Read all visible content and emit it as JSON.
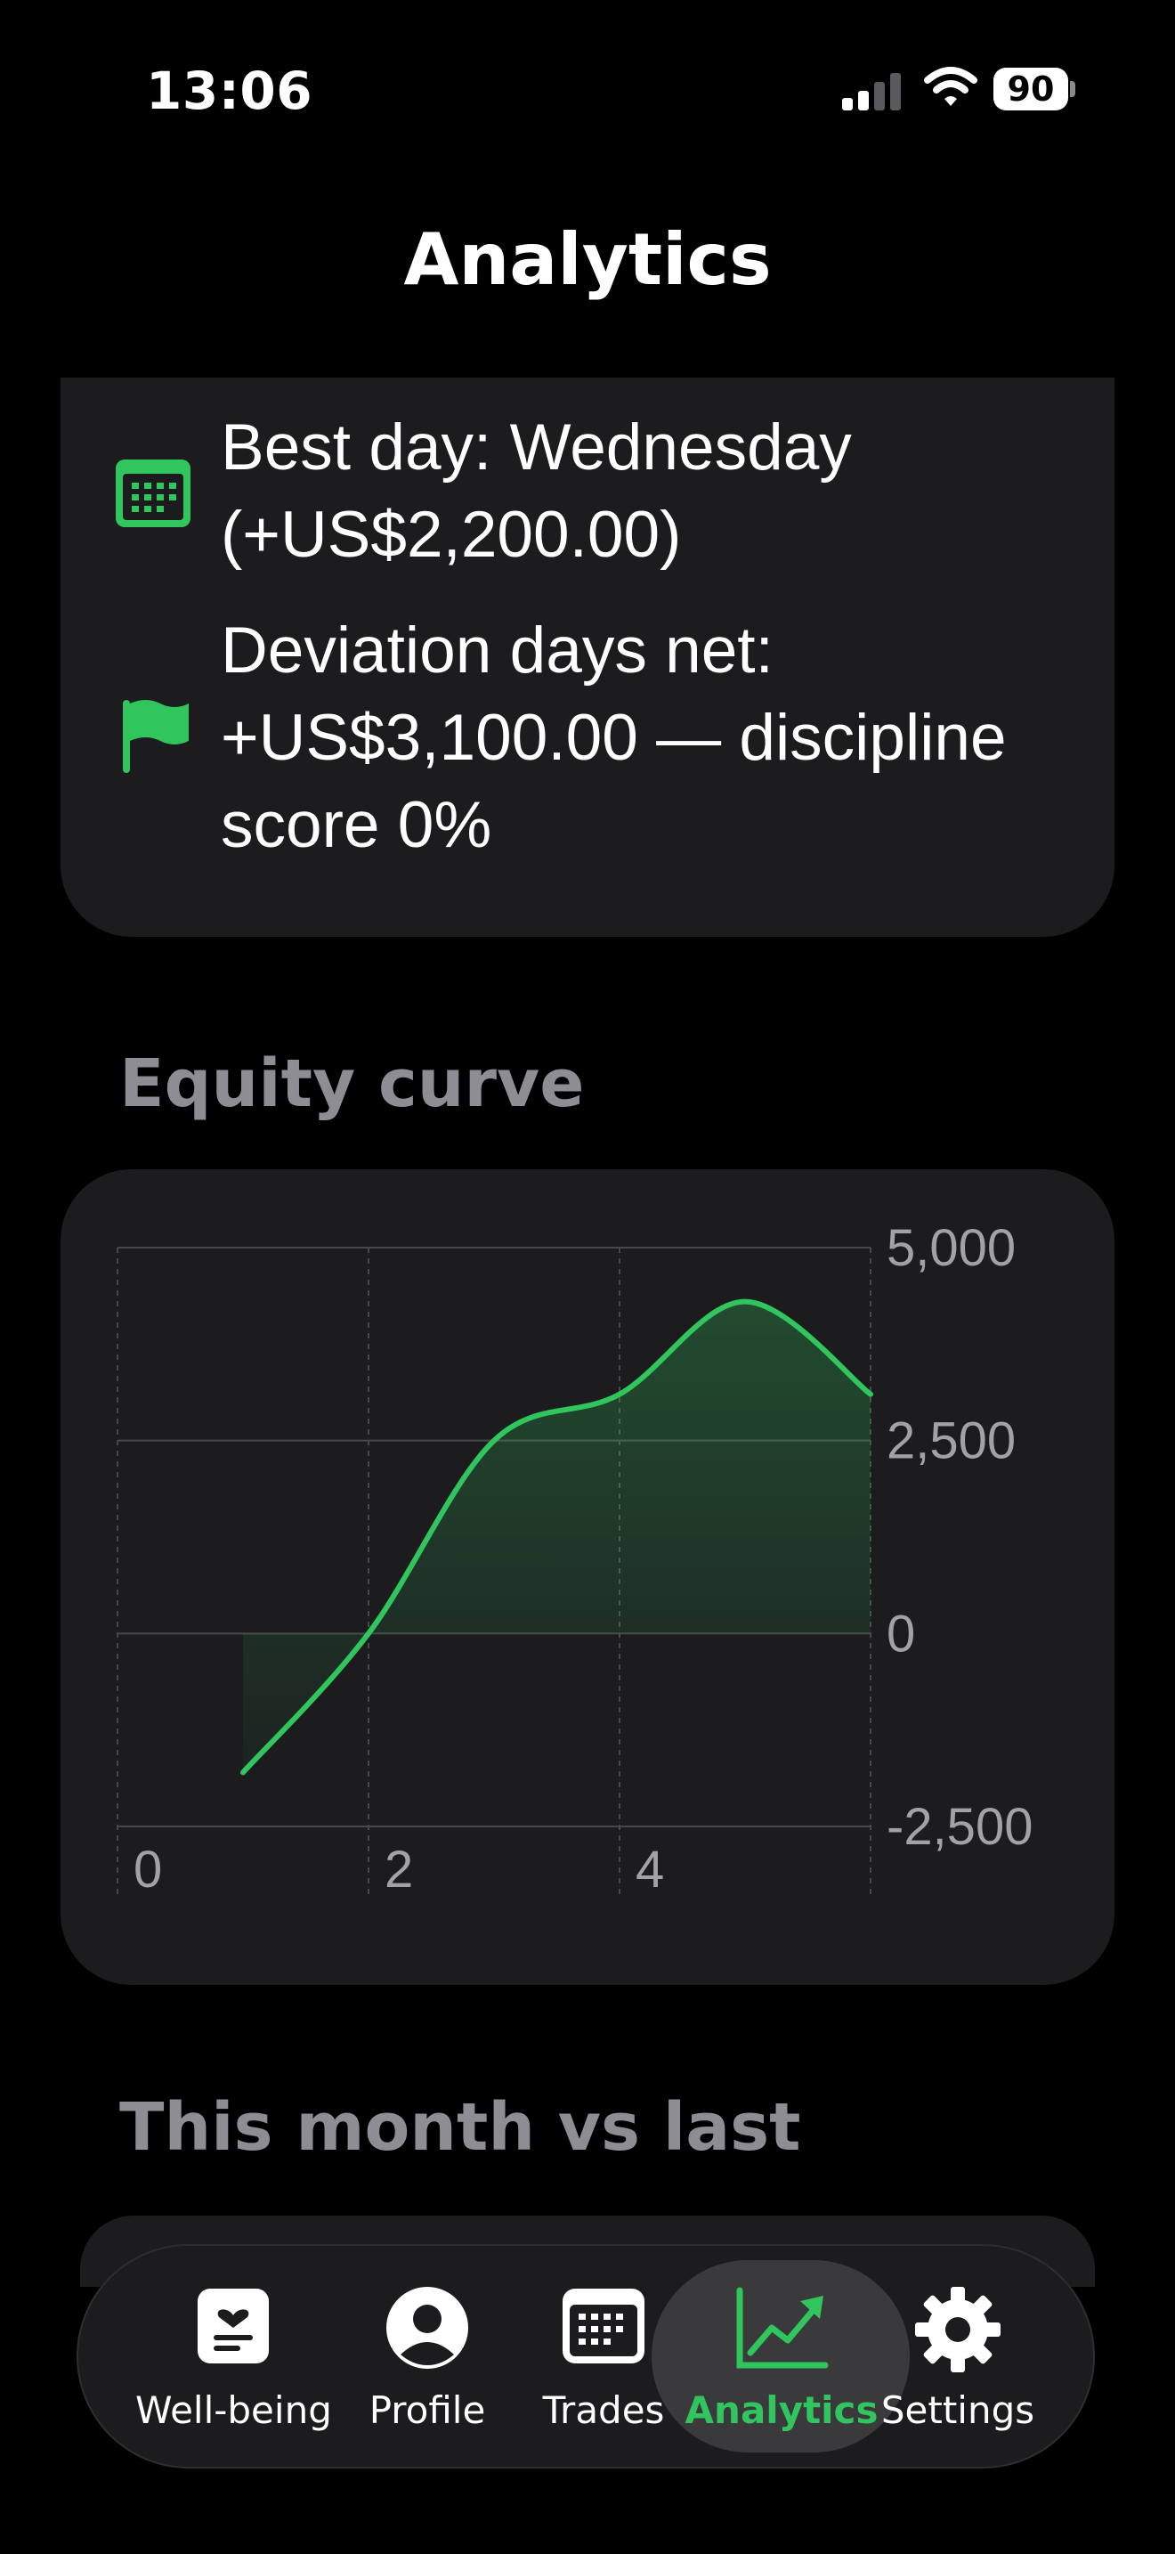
{
  "status_bar": {
    "time": "13:06",
    "battery_percent": "90",
    "icons": [
      "signal-icon",
      "wifi-icon",
      "battery-icon"
    ]
  },
  "page": {
    "title": "Analytics"
  },
  "insights": {
    "best_day": "Best day: Wednesday (+US$2,200.00)",
    "deviation": "Deviation days net: +US$3,100.00 — discipline score 0%",
    "icons": [
      "calendar-icon",
      "flag-icon"
    ]
  },
  "equity_section": {
    "heading": "Equity curve"
  },
  "month_section": {
    "heading": "This month vs last"
  },
  "colors": {
    "accent": "#30c65d",
    "background": "#000000",
    "card": "#1c1c1e",
    "muted_text": "#8d8d93"
  },
  "chart_data": {
    "type": "area",
    "x": [
      1,
      2,
      3,
      4,
      5,
      6
    ],
    "y": [
      -1800,
      0,
      2500,
      3100,
      4300,
      3100
    ],
    "xlim": [
      0,
      6
    ],
    "ylim": [
      -2500,
      5000
    ],
    "x_ticks": [
      0,
      2,
      4
    ],
    "x_tick_labels": [
      "0",
      "2",
      "4"
    ],
    "y_ticks": [
      5000,
      2500,
      0,
      -2500
    ],
    "y_tick_labels": [
      "5,000",
      "2,500",
      "0",
      "-2,500"
    ],
    "grid": true,
    "color": "#30c65d",
    "title": "",
    "xlabel": "",
    "ylabel": ""
  },
  "tab_bar": {
    "items": [
      {
        "label": "Well-being",
        "icon": "wellbeing-icon",
        "active": false
      },
      {
        "label": "Profile",
        "icon": "profile-icon",
        "active": false
      },
      {
        "label": "Trades",
        "icon": "trades-calendar-icon",
        "active": false
      },
      {
        "label": "Analytics",
        "icon": "analytics-chart-icon",
        "active": true
      },
      {
        "label": "Settings",
        "icon": "gear-icon",
        "active": false
      }
    ]
  }
}
